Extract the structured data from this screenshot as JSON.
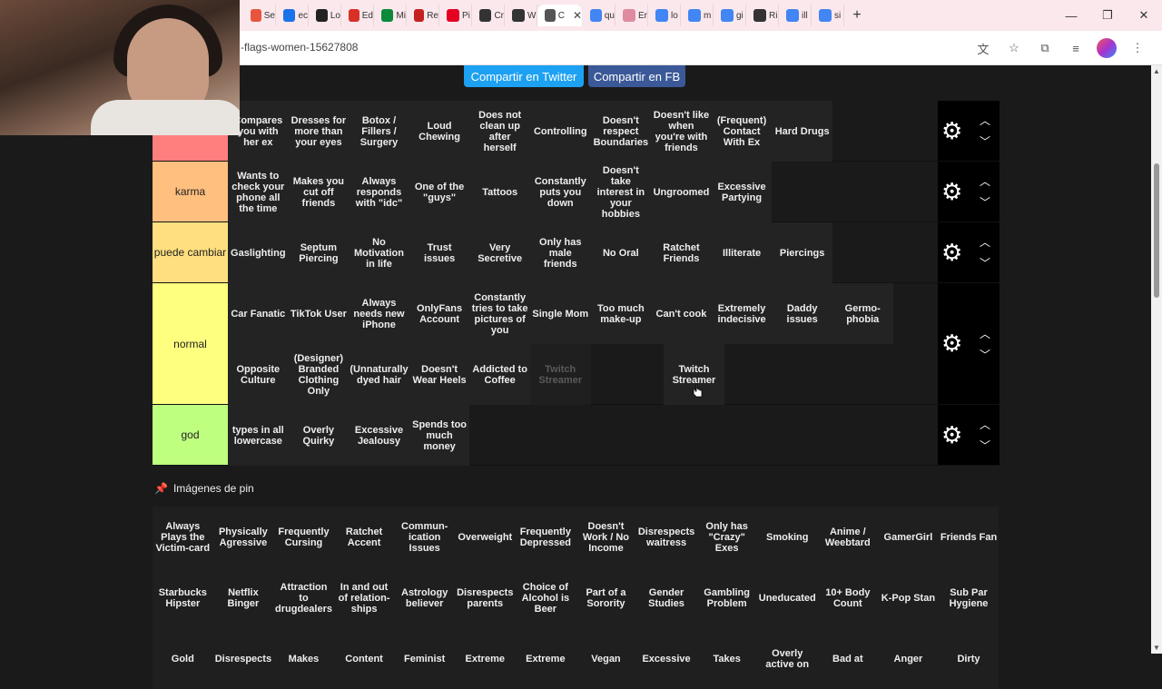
{
  "browser": {
    "tabs": [
      {
        "label": "Se",
        "color": "#e8553e"
      },
      {
        "label": "ec",
        "color": "#1a73e8"
      },
      {
        "label": "Lo",
        "color": "#222222"
      },
      {
        "label": "Ed",
        "color": "#d93025"
      },
      {
        "label": "Mi",
        "color": "#0a8a3a"
      },
      {
        "label": "Re",
        "color": "#c5221f"
      },
      {
        "label": "Pi",
        "color": "#e60023"
      },
      {
        "label": "Cr",
        "color": "#333333"
      },
      {
        "label": "W",
        "color": "#333333"
      },
      {
        "label": "C",
        "color": "#555555",
        "active": true
      },
      {
        "label": "qu",
        "color": "#4285f4"
      },
      {
        "label": "Er",
        "color": "#e08aa0"
      },
      {
        "label": "lo",
        "color": "#4285f4"
      },
      {
        "label": "m",
        "color": "#4285f4"
      },
      {
        "label": "gi",
        "color": "#4285f4"
      },
      {
        "label": "Ri",
        "color": "#333333"
      },
      {
        "label": "ill",
        "color": "#4285f4"
      },
      {
        "label": "si",
        "color": "#4285f4"
      }
    ],
    "new_tab": "+",
    "close_tab": "✕",
    "url": "-flags-women-15627808",
    "controls": {
      "minimize": "—",
      "restore": "❐",
      "close": "✕"
    }
  },
  "share": {
    "twitter": "Compartir en Twitter",
    "facebook": "Compartir en FB"
  },
  "tiers": [
    {
      "label": "",
      "color": "#ff7f7f",
      "items": [
        "Compares you with her ex",
        "Dresses for more than your eyes",
        "Botox / Fillers / Surgery",
        "Loud Chewing",
        "Does not clean up after herself",
        "Controlling",
        "Doesn't respect Boundaries",
        "Doesn't like when you're with friends",
        "(Frequent) Contact With Ex",
        "Hard Drugs"
      ]
    },
    {
      "label": "karma",
      "color": "#ffbf7f",
      "items": [
        "Wants to check your phone all the time",
        "Makes you cut off friends",
        "Always responds with \"idc\"",
        "One of the \"guys\"",
        "Tattoos",
        "Constantly puts you down",
        "Doesn't take interest in your hobbies",
        "Ungroomed",
        "Excessive Partying"
      ]
    },
    {
      "label": "puede cambiar",
      "color": "#ffdf7f",
      "items": [
        "Gaslighting",
        "Septum Piercing",
        "No Motivation in life",
        "Trust issues",
        "Very Secretive",
        "Only has male friends",
        "No Oral",
        "Ratchet Friends",
        "Illiterate",
        "Piercings"
      ]
    },
    {
      "label": "normal",
      "color": "#ffff7f",
      "items": [
        "Car Fanatic",
        "TikTok User",
        "Always needs new iPhone",
        "OnlyFans Account",
        "Constantly tries to take pictures of you",
        "Single Mom",
        "Too much make-up",
        "Can't cook",
        "Extremely indecisive",
        "Daddy issues",
        "Germo-phobia",
        "Opposite Culture",
        "(Designer) Branded Clothing Only",
        "(Unnaturally dyed hair",
        "Doesn't Wear Heels",
        "Addicted to Coffee",
        "Twitch Streamer"
      ]
    },
    {
      "label": "god",
      "color": "#bfff7f",
      "items": [
        "types in all lowercase",
        "Overly Quirky",
        "Excessive Jealousy",
        "Spends too much money"
      ]
    }
  ],
  "dragging_item": "Twitch Streamer",
  "pool": {
    "title": "Imágenes de pin",
    "items": [
      "Always Plays the Victim-card",
      "Physically Agressive",
      "Frequently Cursing",
      "Ratchet Accent",
      "Commun-ication Issues",
      "Overweight",
      "Frequently Depressed",
      "Doesn't Work / No Income",
      "Disrespects waitress",
      "Only has \"Crazy\" Exes",
      "Smoking",
      "Anime / Weebtard",
      "GamerGirl",
      "Friends Fan",
      "Starbucks Hipster",
      "Netflix Binger",
      "Attraction to drugdealers",
      "In and out of relation-ships",
      "Astrology believer",
      "Disrespects parents",
      "Choice of Alcohol is Beer",
      "Part of a Sorority",
      "Gender Studies",
      "Gambling Problem",
      "Uneducated",
      "10+ Body Count",
      "K-Pop Stan",
      "Sub Par Hygiene",
      "Gold",
      "Disrespects",
      "Makes",
      "Content",
      "Feminist",
      "Extreme",
      "Extreme",
      "Vegan",
      "Excessive",
      "Takes",
      "Overly active on",
      "Bad at",
      "Anger",
      "Dirty"
    ]
  },
  "icons": {
    "gear": "gear-icon",
    "up": "chevron-up-icon",
    "down": "chevron-down-icon",
    "pin": "pin-icon"
  }
}
